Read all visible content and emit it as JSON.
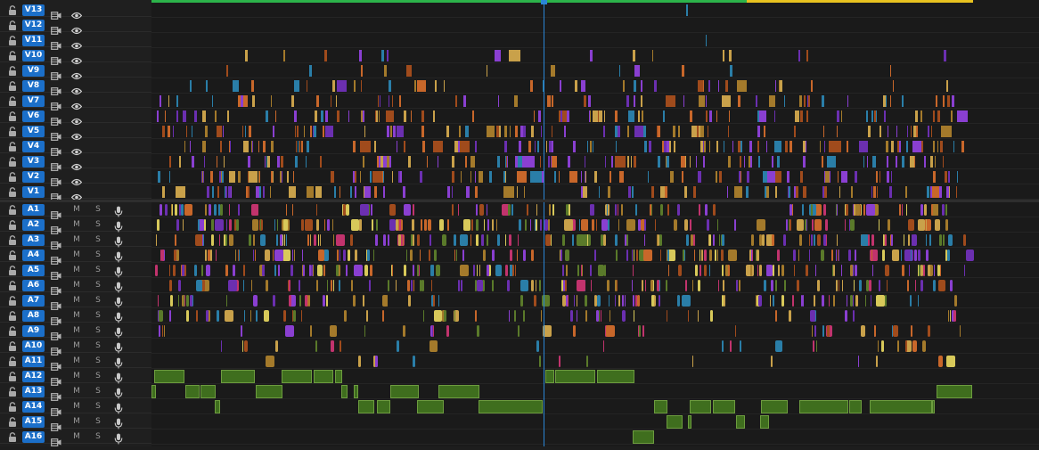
{
  "video_tracks": [
    "V13",
    "V12",
    "V11",
    "V10",
    "V9",
    "V8",
    "V7",
    "V6",
    "V5",
    "V4",
    "V3",
    "V2",
    "V1"
  ],
  "audio_tracks": [
    "A1",
    "A2",
    "A3",
    "A4",
    "A5",
    "A6",
    "A7",
    "A8",
    "A9",
    "A10",
    "A11",
    "A12",
    "A13",
    "A14",
    "A15",
    "A16"
  ],
  "audio_buttons": {
    "mute": "M",
    "solo": "S"
  },
  "icons": {
    "lock": "lock-icon",
    "camera": "film-toggle-icon",
    "eye": "eye-icon",
    "mic": "microphone-icon"
  },
  "colors": {
    "track_label_bg": "#1b6fc9",
    "playhead": "#2a86d6",
    "render_bar_green": "#2cb34a",
    "render_bar_yellow": "#e8c21f",
    "clip_green": "#3f6e1e",
    "clip_palette": [
      "#8a3fd1",
      "#6b2fb0",
      "#c9a14a",
      "#a47a2b",
      "#c8672a",
      "#a04b1c",
      "#2a7ea8",
      "#c1336d",
      "#d8c95a",
      "#5a7a2a"
    ]
  }
}
